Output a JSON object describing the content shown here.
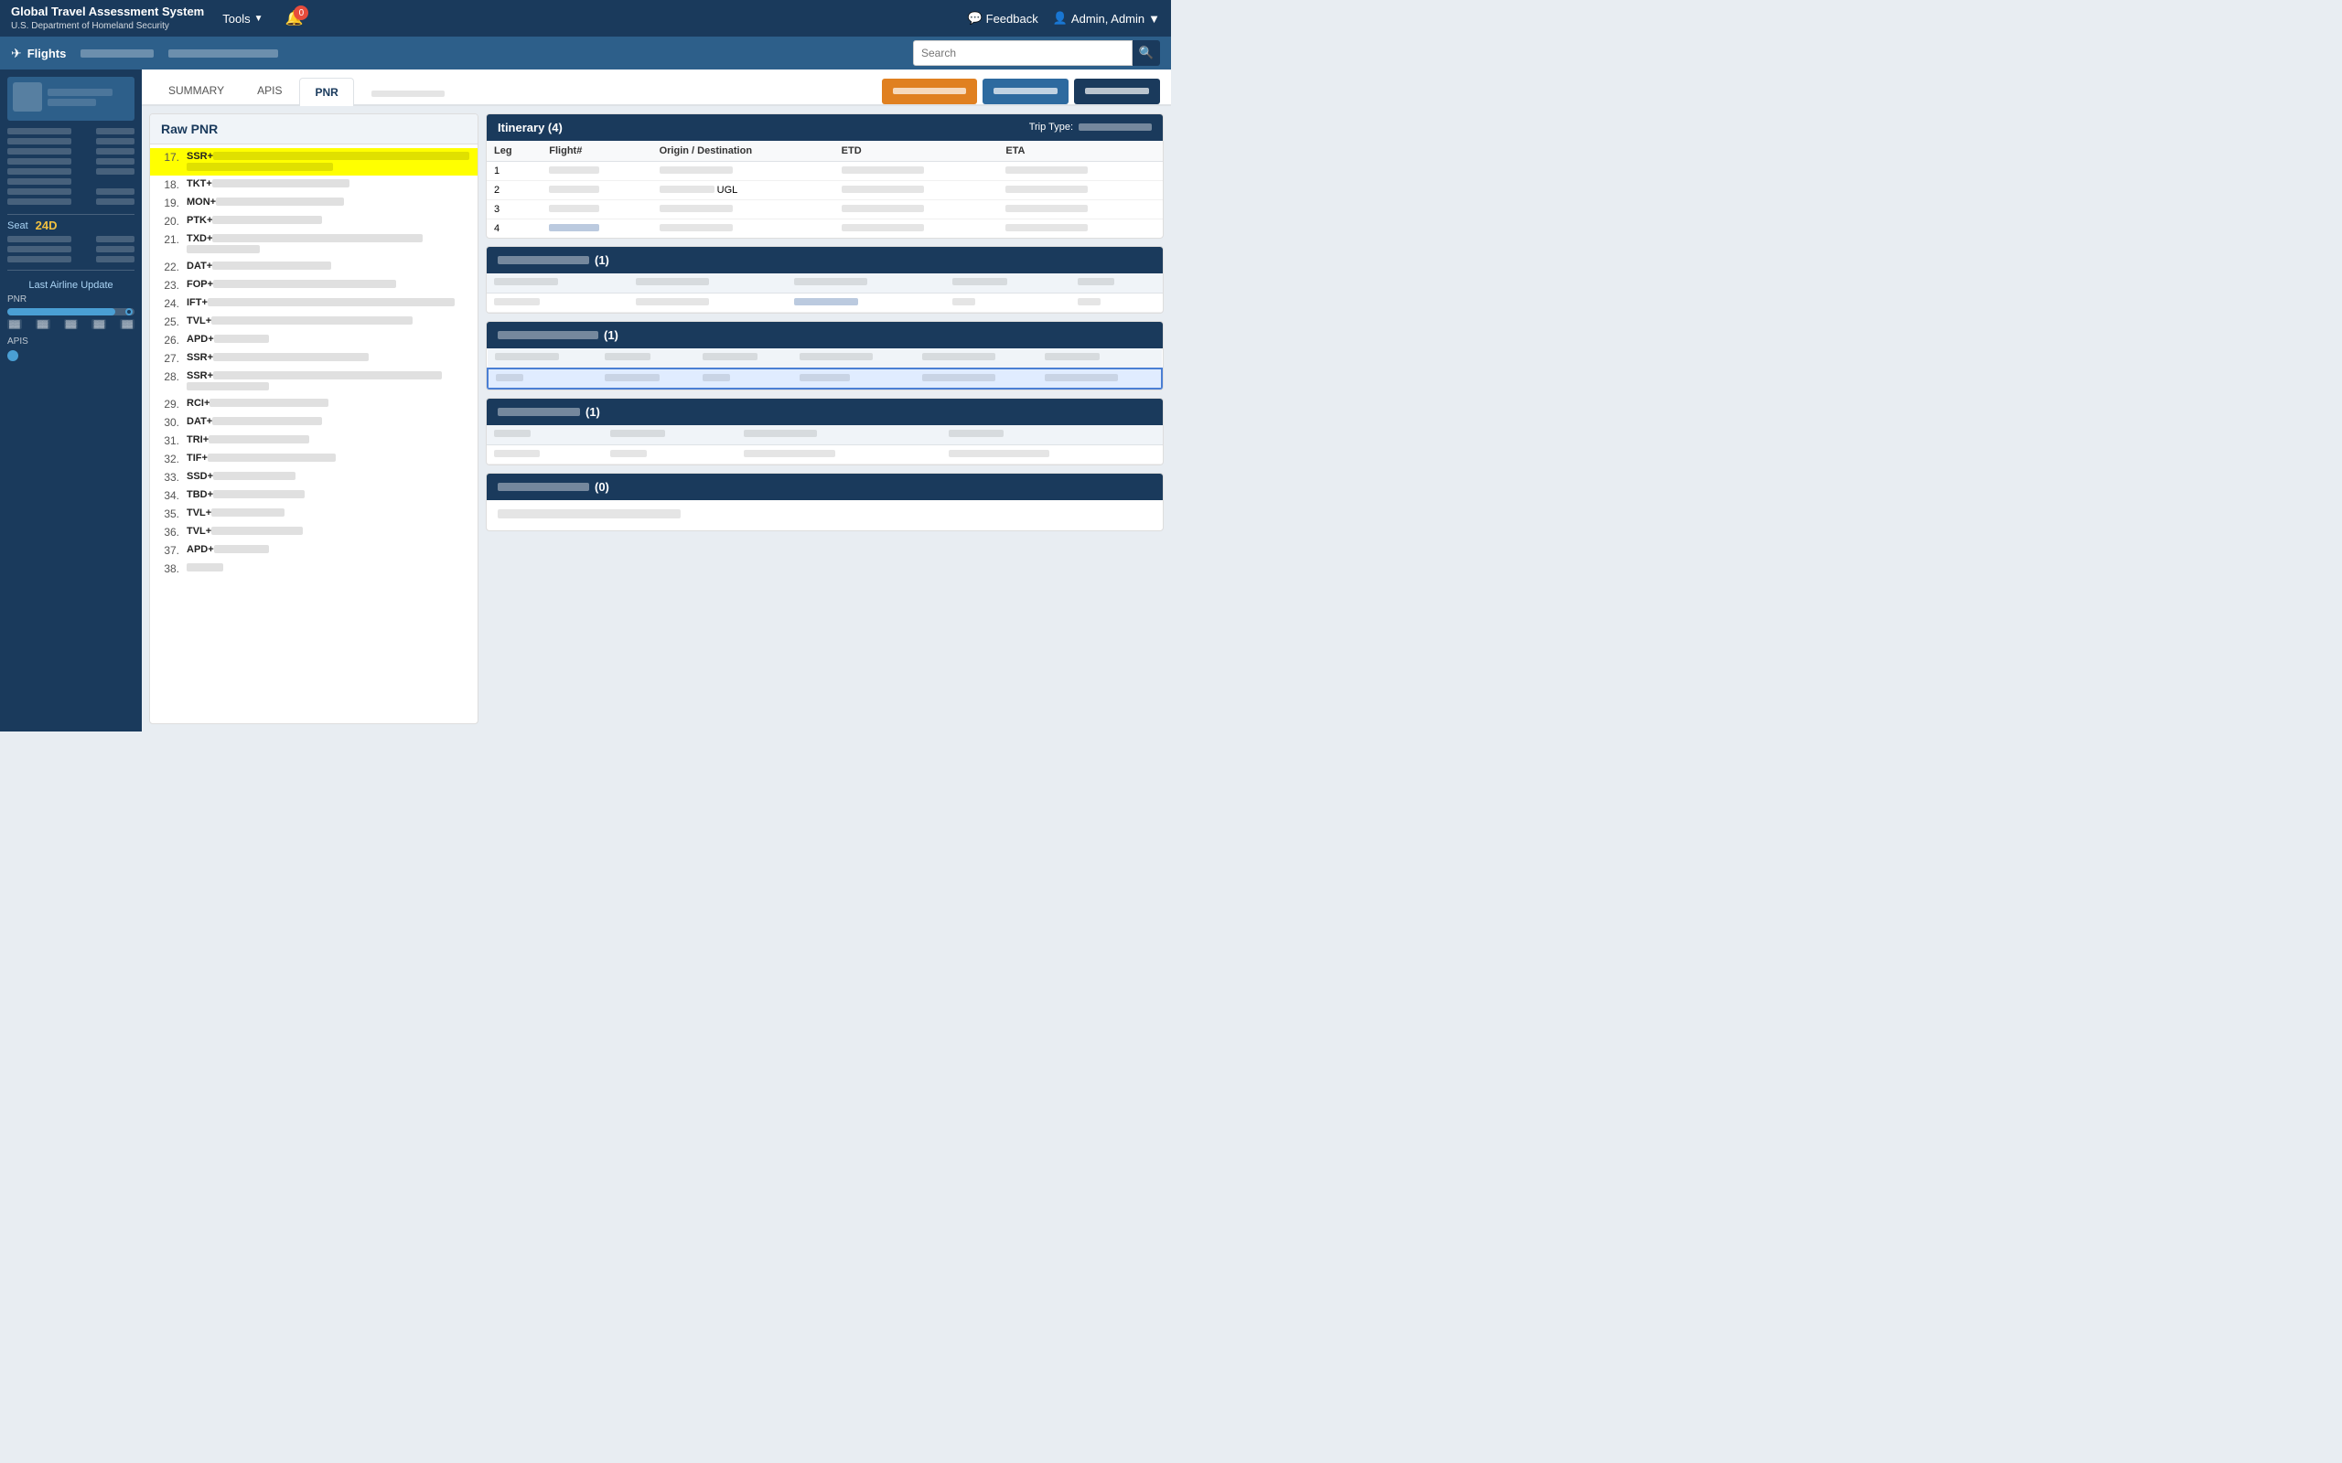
{
  "app": {
    "title": "Global Travel Assessment System",
    "subtitle": "U.S. Department of Homeland Security"
  },
  "topnav": {
    "tools_label": "Tools",
    "notification_count": "0",
    "feedback_label": "Feedback",
    "admin_label": "Admin, Admin"
  },
  "subnav": {
    "flights_label": "Flights",
    "search_placeholder": "Search"
  },
  "sidebar": {
    "seat_label": "Seat",
    "seat_value": "24D",
    "last_airline_label": "Last Airline Update",
    "pnr_label": "PNR",
    "apis_label": "APIS"
  },
  "tabs": {
    "summary": "SUMMARY",
    "apis": "APIS",
    "pnr": "PNR",
    "btn1": "▓▓▓▓▓▓▓▓▓▓▓▓",
    "btn2": "▓▓▓▓▓▓▓▓▓▓",
    "btn3": "▓▓▓▓▓▓▓▓▓▓"
  },
  "rawpnr": {
    "title": "Raw PNR",
    "rows": [
      {
        "num": "17.",
        "label": "SSR+",
        "content": "highlighted"
      },
      {
        "num": "18.",
        "label": "TKT+",
        "content": ""
      },
      {
        "num": "19.",
        "label": "MON+",
        "content": ""
      },
      {
        "num": "20.",
        "label": "PTK+",
        "content": ""
      },
      {
        "num": "21.",
        "label": "TXD+",
        "content": "",
        "multiline": true
      },
      {
        "num": "22.",
        "label": "DAT+",
        "content": ""
      },
      {
        "num": "23.",
        "label": "FOP+",
        "content": ""
      },
      {
        "num": "24.",
        "label": "IFT+",
        "content": ""
      },
      {
        "num": "25.",
        "label": "TVL+",
        "content": ""
      },
      {
        "num": "26.",
        "label": "APD+",
        "content": ""
      },
      {
        "num": "27.",
        "label": "SSR+",
        "content": ""
      },
      {
        "num": "28.",
        "label": "SSR+",
        "content": "",
        "multiline": true
      },
      {
        "num": "29.",
        "label": "RCI+",
        "content": ""
      },
      {
        "num": "30.",
        "label": "DAT+",
        "content": ""
      },
      {
        "num": "31.",
        "label": "TRI+",
        "content": ""
      },
      {
        "num": "32.",
        "label": "TIF+",
        "content": ""
      },
      {
        "num": "33.",
        "label": "SSD+",
        "content": ""
      },
      {
        "num": "34.",
        "label": "TBD+",
        "content": ""
      },
      {
        "num": "35.",
        "label": "TVL+",
        "content": ""
      },
      {
        "num": "36.",
        "label": "TVL+",
        "content": ""
      },
      {
        "num": "37.",
        "label": "APD+",
        "content": ""
      },
      {
        "num": "38.",
        "label": "",
        "content": ""
      }
    ]
  },
  "itinerary": {
    "title": "Itinerary (4)",
    "trip_type_label": "Trip Type:",
    "columns": [
      "Leg",
      "Flight#",
      "Origin / Destination",
      "ETD",
      "ETA"
    ],
    "rows": [
      {
        "leg": "1",
        "flight": "",
        "origin": "",
        "etd": "",
        "eta": ""
      },
      {
        "leg": "2",
        "flight": "",
        "origin": "UGL",
        "etd": "",
        "eta": ""
      },
      {
        "leg": "3",
        "flight": "",
        "origin": "",
        "etd": "",
        "eta": ""
      },
      {
        "leg": "4",
        "flight": "",
        "origin": "",
        "etd": "",
        "eta": "",
        "highlight": true
      }
    ]
  },
  "section2": {
    "title": "(1)",
    "columns": [
      "",
      "",
      "",
      "",
      ""
    ],
    "rows": [
      {
        "cells": [
          "",
          "",
          "",
          "",
          ""
        ]
      },
      {
        "cells": [
          "",
          "",
          "",
          "",
          ""
        ],
        "link": true
      }
    ]
  },
  "section3": {
    "title": "(1)",
    "columns": [
      "",
      "",
      "",
      "",
      "",
      ""
    ],
    "rows": [
      {
        "cells": [
          "",
          "",
          "",
          "",
          "",
          ""
        ],
        "highlight": true
      }
    ]
  },
  "section4": {
    "title": "(1)",
    "columns": [
      "",
      "",
      "",
      ""
    ],
    "rows": [
      {
        "cells": [
          "",
          "",
          "",
          ""
        ]
      },
      {
        "cells": [
          "",
          "",
          "",
          ""
        ]
      }
    ]
  },
  "section5": {
    "title": "(0)",
    "no_data": ""
  }
}
